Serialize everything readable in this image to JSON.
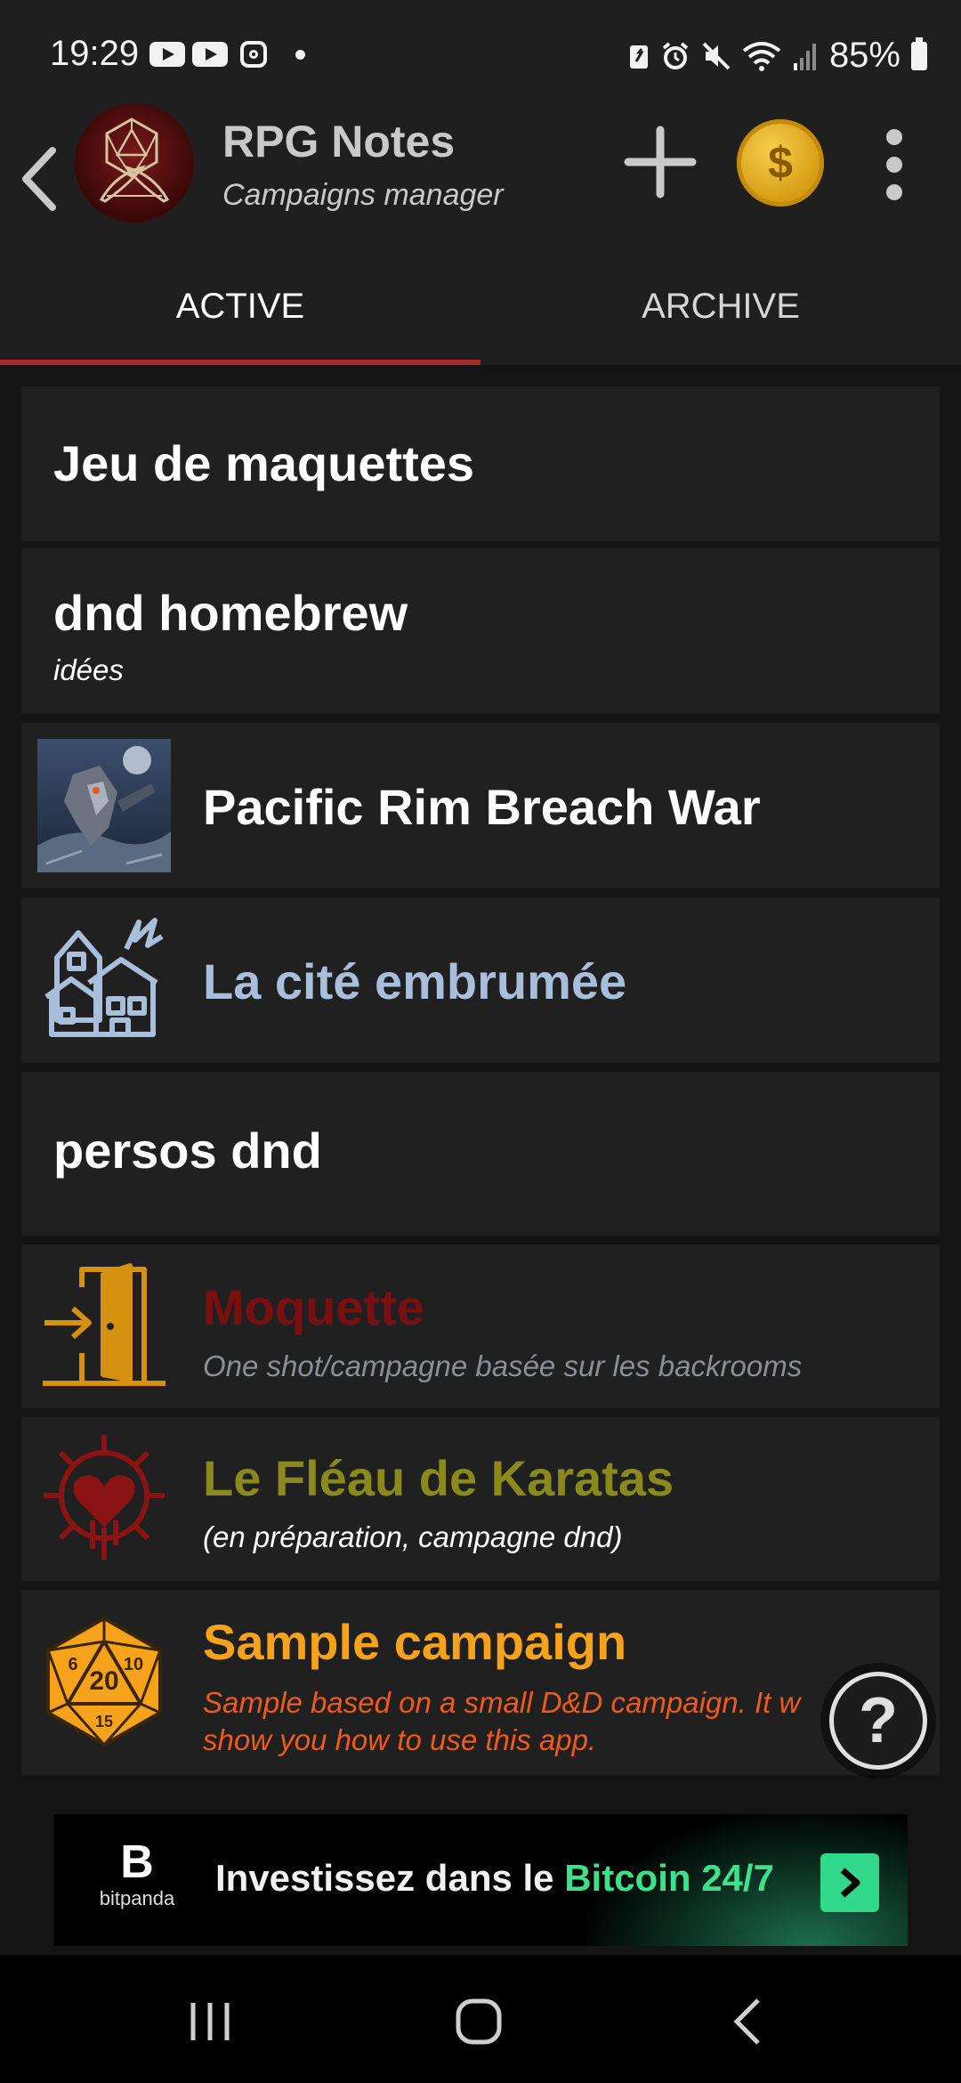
{
  "status_bar": {
    "time": "19:29",
    "battery_percent": "85%",
    "icons": [
      "youtube-icon",
      "youtube-icon",
      "instagram-icon",
      "notification-dot",
      "battery-saver-icon",
      "alarm-icon",
      "mute-icon",
      "wifi-icon",
      "signal-icon",
      "battery-icon"
    ]
  },
  "app_bar": {
    "title": "RPG Notes",
    "subtitle": "Campaigns manager",
    "icons": [
      "back-arrow-icon",
      "d20-quill-logo",
      "plus-icon",
      "dollar-coin-icon",
      "more-vert-icon"
    ]
  },
  "tabs": [
    {
      "label": "ACTIVE",
      "selected": true
    },
    {
      "label": "ARCHIVE",
      "selected": false
    }
  ],
  "colors": {
    "background": "#141414",
    "card": "#202020",
    "tab_indicator": "#a82a2a",
    "brand_coin": "#e8b422"
  },
  "campaigns": [
    {
      "title": "Jeu de maquettes",
      "subtitle": "",
      "icon": "",
      "title_color": "#ffffff"
    },
    {
      "title": "dnd homebrew",
      "subtitle": "idées",
      "icon": "",
      "title_color": "#ffffff",
      "subtitle_color": "#ffffff"
    },
    {
      "title": "Pacific Rim Breach War",
      "subtitle": "",
      "icon": "mech-battle-image",
      "title_color": "#ffffff"
    },
    {
      "title": "La cité embrumée",
      "subtitle": "",
      "icon": "haunted-house-icon",
      "title_color": "#a9bedb"
    },
    {
      "title": "persos dnd",
      "subtitle": "",
      "icon": "",
      "title_color": "#ffffff"
    },
    {
      "title": "Moquette",
      "subtitle": "One shot/campagne basée sur les backrooms",
      "icon": "door-enter-icon",
      "title_color": "#7a0f12",
      "subtitle_color": "#8a8f96"
    },
    {
      "title": "Le Fléau de Karatas",
      "subtitle": "(en préparation, campagne dnd)",
      "icon": "spiked-heart-icon",
      "title_color": "#8a8a1c",
      "subtitle_color": "#ffffff"
    },
    {
      "title": "Sample campaign",
      "subtitle_line1": "Sample based on a small D&D campaign. It w",
      "subtitle_line2": "show you how to use this app.",
      "icon": "d20-dice-icon",
      "title_color": "#f7a21b",
      "subtitle_color": "#f05a1a"
    }
  ],
  "help_button": {
    "label": "?"
  },
  "ad": {
    "brand": "bitpanda",
    "text": "Investissez dans le ",
    "highlight": "Bitcoin 24/7"
  },
  "nav_bar": {
    "icons": [
      "recent-apps-icon",
      "home-icon",
      "back-icon"
    ]
  }
}
